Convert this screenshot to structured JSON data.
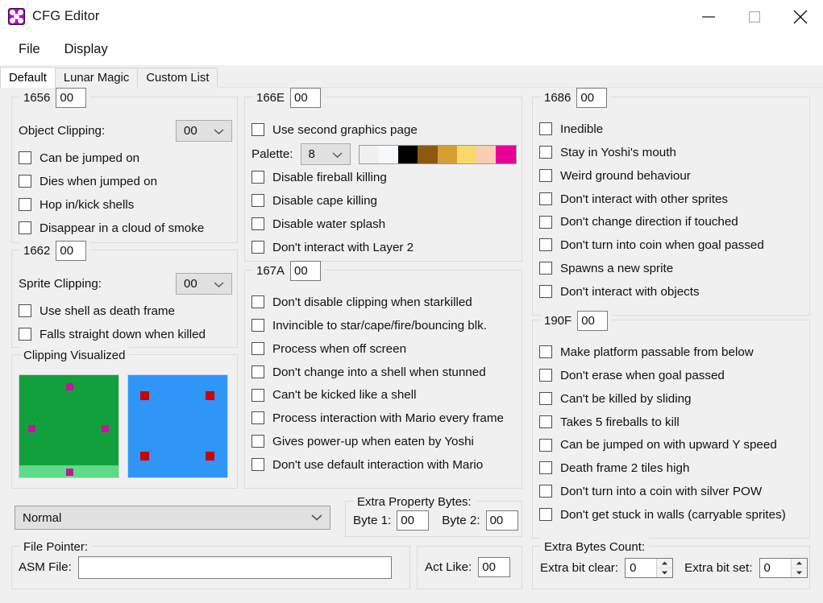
{
  "window": {
    "title": "CFG Editor",
    "icon": "app-sprite-icon",
    "minimize": "minimize-icon",
    "maximize": "maximize-icon",
    "close": "close-icon"
  },
  "menubar": {
    "items": [
      {
        "label": "File"
      },
      {
        "label": "Display"
      }
    ]
  },
  "tabs": [
    {
      "label": "Default",
      "active": true
    },
    {
      "label": "Lunar Magic",
      "active": false
    },
    {
      "label": "Custom List",
      "active": false
    }
  ],
  "groups": {
    "g1656": {
      "legend": "1656",
      "hex_value": "00",
      "clipping_label": "Object Clipping:",
      "clipping_value": "00",
      "checkboxes": [
        {
          "label": "Can be jumped on",
          "checked": false
        },
        {
          "label": "Dies when jumped on",
          "checked": false
        },
        {
          "label": "Hop in/kick shells",
          "checked": false
        },
        {
          "label": "Disappear in a cloud of smoke",
          "checked": false
        }
      ]
    },
    "g1662": {
      "legend": "1662",
      "hex_value": "00",
      "clipping_label": "Sprite Clipping:",
      "clipping_value": "00",
      "checkboxes": [
        {
          "label": "Use shell as death frame",
          "checked": false
        },
        {
          "label": "Falls straight down when killed",
          "checked": false
        }
      ]
    },
    "clipping_visualized": {
      "legend": "Clipping Visualized",
      "object_box_color": "#12a03c",
      "object_box_floor_color": "#5edb86",
      "object_marker_color": "#c2169e",
      "sprite_box_color": "#2f95f7",
      "sprite_marker_color": "#cc0000"
    },
    "g166E": {
      "legend": "166E",
      "hex_value": "00",
      "first_checkbox": {
        "label": "Use second graphics page",
        "checked": false
      },
      "palette_label": "Palette:",
      "palette_value": "8",
      "palette_colors": [
        "#0b61b",
        "#f7f8f9",
        "#000000",
        "#8a5a12",
        "#d59f33",
        "#f7d96a",
        "#f7cdb4",
        "#e80099"
      ],
      "checkboxes": [
        {
          "label": "Disable fireball killing",
          "checked": false
        },
        {
          "label": "Disable cape killing",
          "checked": false
        },
        {
          "label": "Disable water splash",
          "checked": false
        },
        {
          "label": "Don't interact with Layer 2",
          "checked": false
        }
      ]
    },
    "g167A": {
      "legend": "167A",
      "hex_value": "00",
      "checkboxes": [
        {
          "label": "Don't disable clipping when starkilled",
          "checked": false
        },
        {
          "label": "Invincible to star/cape/fire/bouncing blk.",
          "checked": false
        },
        {
          "label": "Process when off screen",
          "checked": false
        },
        {
          "label": "Don't change into a shell when stunned",
          "checked": false
        },
        {
          "label": "Can't be kicked like a shell",
          "checked": false
        },
        {
          "label": "Process interaction with Mario every frame",
          "checked": false
        },
        {
          "label": "Gives power-up when eaten by Yoshi",
          "checked": false
        },
        {
          "label": "Don't use default interaction with Mario",
          "checked": false
        }
      ]
    },
    "g1686": {
      "legend": "1686",
      "hex_value": "00",
      "checkboxes": [
        {
          "label": "Inedible",
          "checked": false
        },
        {
          "label": "Stay in Yoshi's mouth",
          "checked": false
        },
        {
          "label": "Weird ground behaviour",
          "checked": false
        },
        {
          "label": "Don't interact with other sprites",
          "checked": false
        },
        {
          "label": "Don't change direction if touched",
          "checked": false
        },
        {
          "label": "Don't turn into coin when goal passed",
          "checked": false
        },
        {
          "label": "Spawns a new sprite",
          "checked": false
        },
        {
          "label": "Don't interact with objects",
          "checked": false
        }
      ]
    },
    "g190F": {
      "legend": "190F",
      "hex_value": "00",
      "checkboxes": [
        {
          "label": "Make platform passable from below",
          "checked": false
        },
        {
          "label": "Don't erase when goal passed",
          "checked": false
        },
        {
          "label": "Can't be killed by sliding",
          "checked": false
        },
        {
          "label": "Takes 5 fireballs to kill",
          "checked": false
        },
        {
          "label": "Can be jumped on with upward Y speed",
          "checked": false
        },
        {
          "label": "Death frame 2 tiles high",
          "checked": false
        },
        {
          "label": "Don't turn into a coin with silver POW",
          "checked": false
        },
        {
          "label": "Don't get stuck in walls (carryable sprites)",
          "checked": false
        }
      ]
    },
    "extra_property_bytes": {
      "legend": "Extra Property Bytes:",
      "byte1_label": "Byte 1:",
      "byte1_value": "00",
      "byte2_label": "Byte 2:",
      "byte2_value": "00"
    },
    "file_pointer": {
      "legend": "File Pointer:",
      "asm_label": "ASM File:",
      "asm_value": "",
      "asm_placeholder": ""
    },
    "act_like": {
      "label": "Act Like:",
      "value": "00"
    },
    "extra_bytes_count": {
      "legend": "Extra Bytes Count:",
      "clear_label": "Extra bit clear:",
      "clear_value": "0",
      "set_label": "Extra bit set:",
      "set_value": "0"
    }
  },
  "sprite_type": {
    "value": "Normal"
  }
}
